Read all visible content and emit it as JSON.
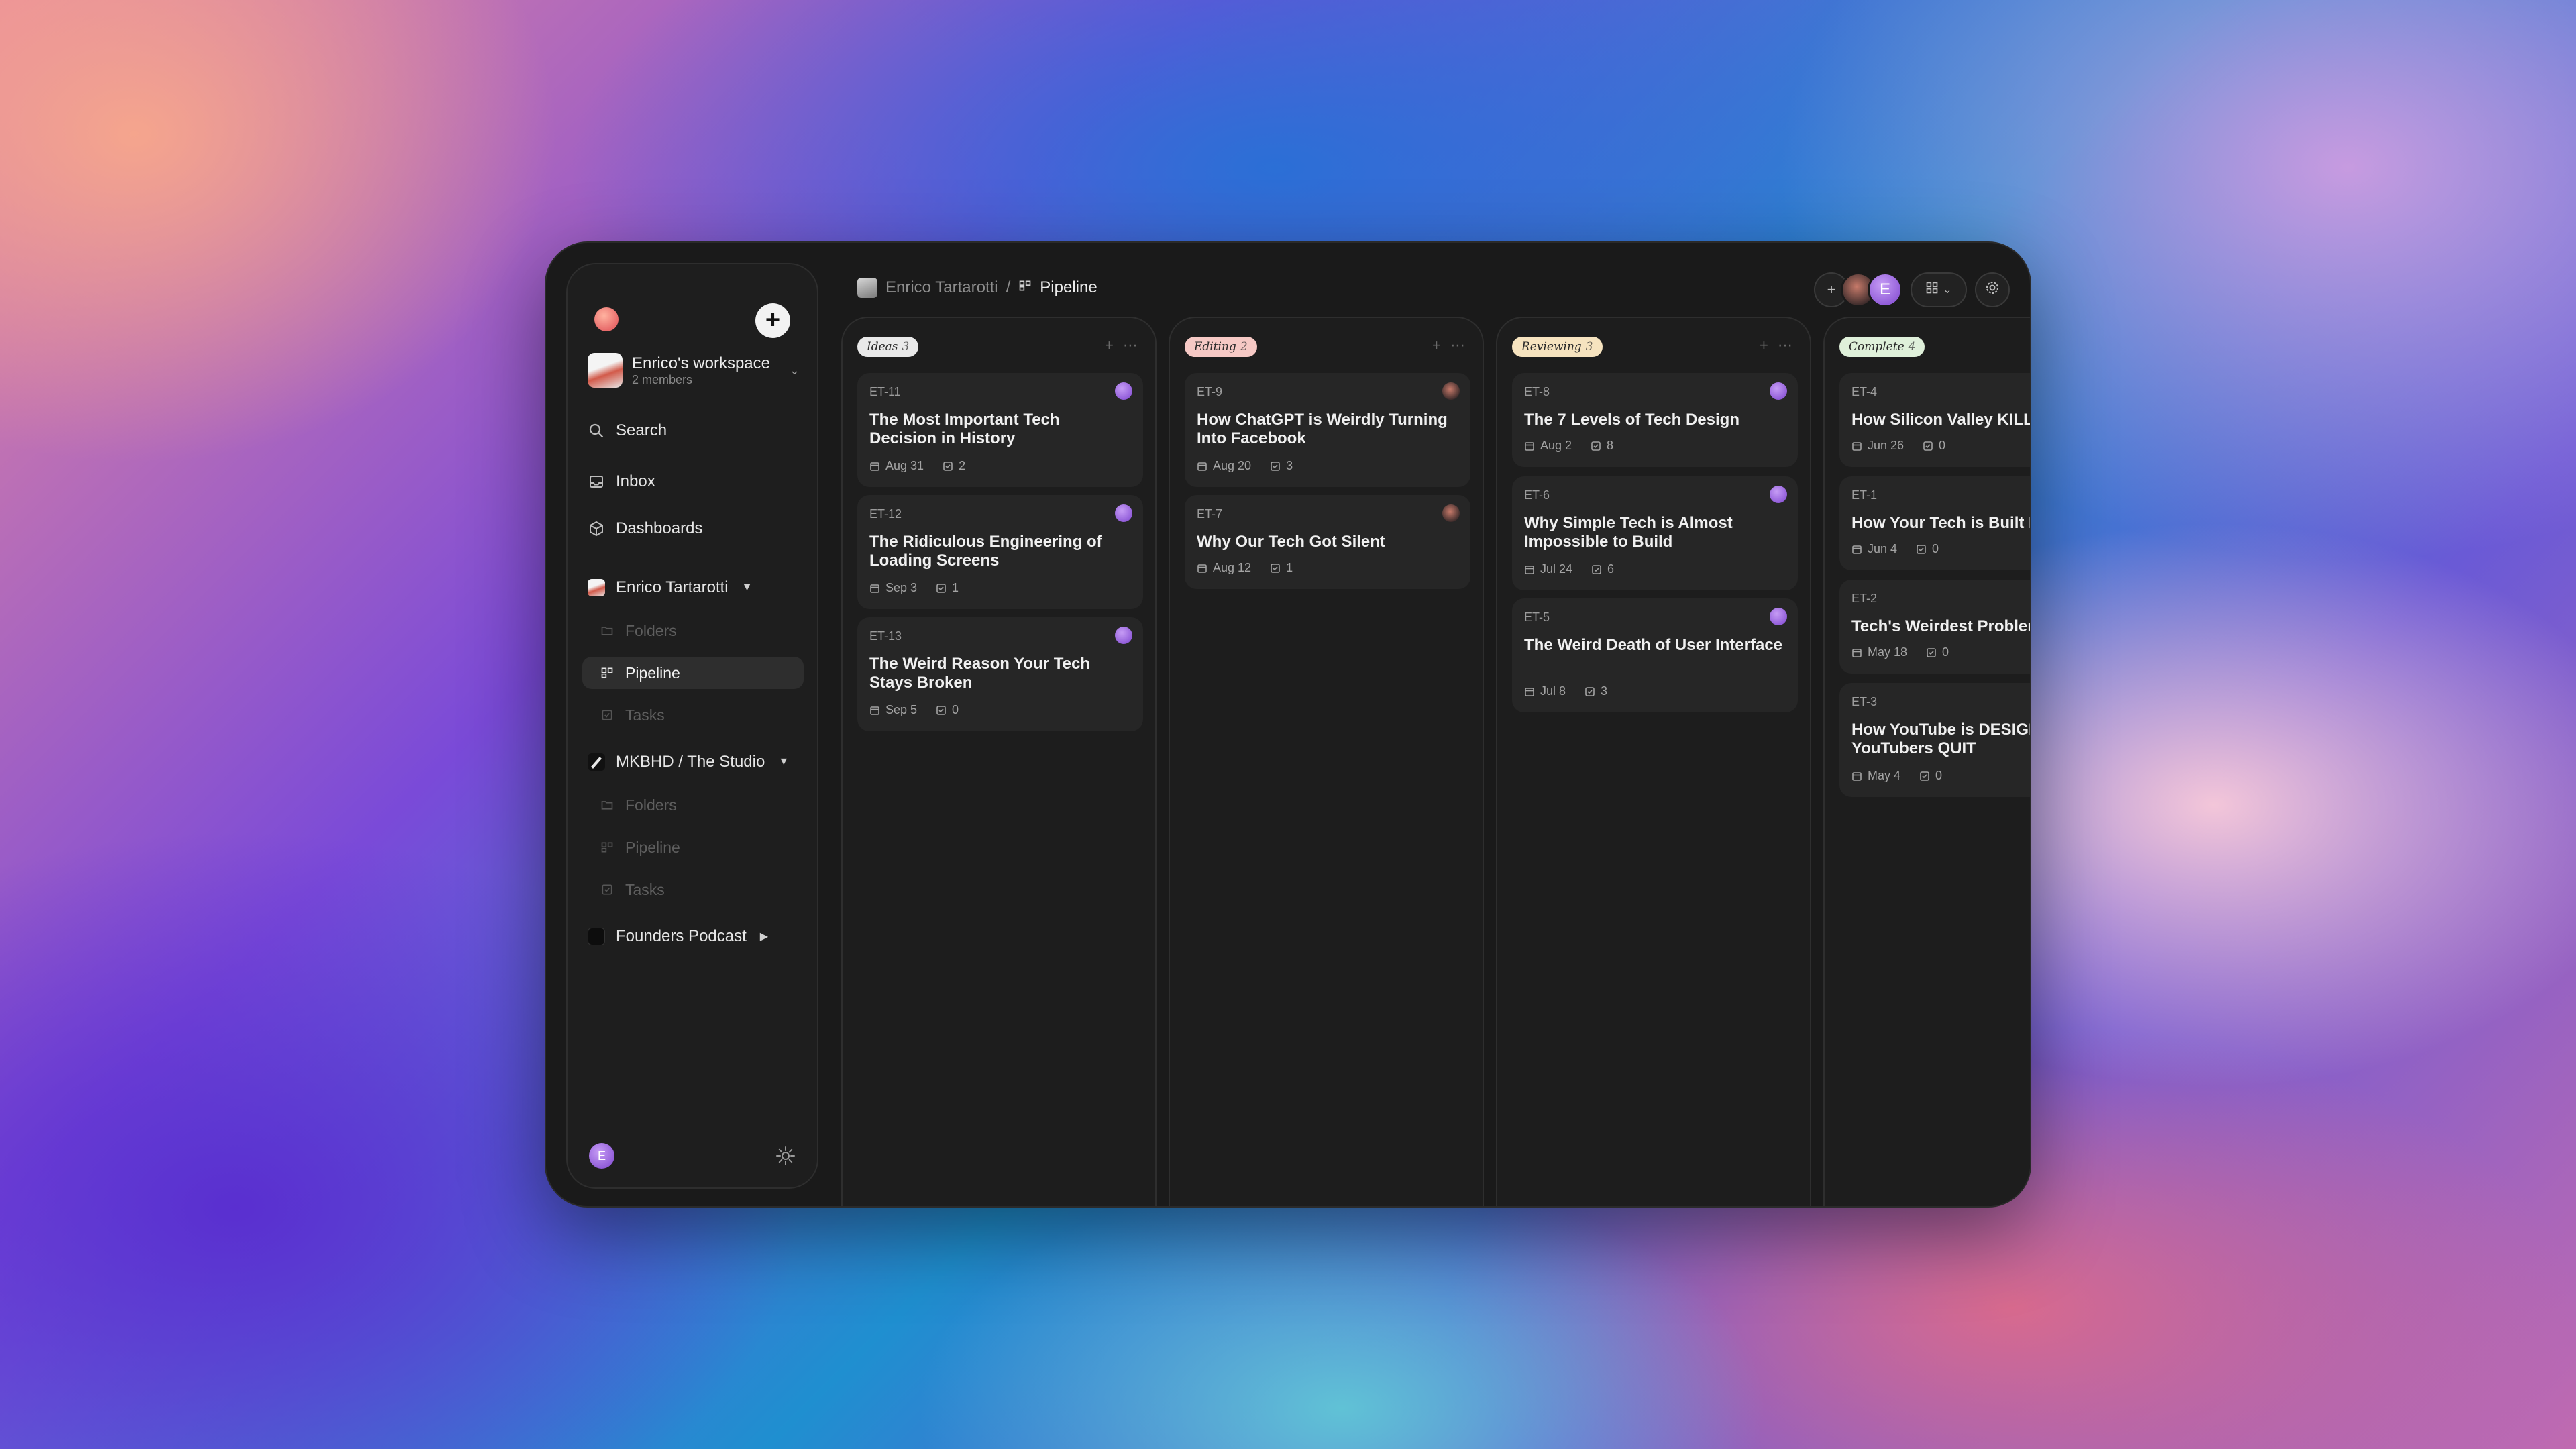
{
  "app": {
    "workspace_name": "Enrico's workspace",
    "workspace_members": "2 members"
  },
  "sidebar": {
    "search_label": "Search",
    "inbox_label": "Inbox",
    "dashboards_label": "Dashboards",
    "projects": [
      {
        "name": "Enrico Tartarotti",
        "items": [
          {
            "label": "Folders",
            "active": false
          },
          {
            "label": "Pipeline",
            "active": true
          },
          {
            "label": "Tasks",
            "active": false
          }
        ]
      },
      {
        "name": "MKBHD / The Studio",
        "items": [
          {
            "label": "Folders",
            "active": false
          },
          {
            "label": "Pipeline",
            "active": false
          },
          {
            "label": "Tasks",
            "active": false
          }
        ]
      },
      {
        "name": "Founders Podcast",
        "items": []
      }
    ],
    "user_initial": "E"
  },
  "header": {
    "breadcrumb_parent": "Enrico Tartarotti",
    "breadcrumb_sep": "/",
    "breadcrumb_current": "Pipeline",
    "avatar_initial": "E"
  },
  "board": {
    "columns": [
      {
        "name": "Ideas",
        "count": "3",
        "color": "#e9e9e9",
        "cards": [
          {
            "id": "ET-11",
            "title": "The Most Important Tech Decision in History",
            "date": "Aug 31",
            "tasks": "2"
          },
          {
            "id": "ET-12",
            "title": "The Ridiculous Engineering of Loading Screens",
            "date": "Sep 3",
            "tasks": "1"
          },
          {
            "id": "ET-13",
            "title": "The Weird Reason Your Tech Stays Broken",
            "date": "Sep 5",
            "tasks": "0"
          }
        ]
      },
      {
        "name": "Editing",
        "count": "2",
        "color": "#f6c9c5",
        "cards": [
          {
            "id": "ET-9",
            "title": "How ChatGPT is Weirdly Turning Into Facebook",
            "date": "Aug 20",
            "tasks": "3"
          },
          {
            "id": "ET-7",
            "title": "Why Our Tech Got Silent",
            "date": "Aug 12",
            "tasks": "1"
          }
        ]
      },
      {
        "name": "Reviewing",
        "count": "3",
        "color": "#f6e3bf",
        "cards": [
          {
            "id": "ET-8",
            "title": "The 7 Levels of Tech Design",
            "date": "Aug 2",
            "tasks": "8"
          },
          {
            "id": "ET-6",
            "title": "Why Simple Tech is Almost Impossible to Build",
            "date": "Jul 24",
            "tasks": "6"
          },
          {
            "id": "ET-5",
            "title": "The Weird Death of User Interface",
            "date": "Jul 8",
            "tasks": "3"
          }
        ]
      },
      {
        "name": "Complete",
        "count": "4",
        "color": "#dff0da",
        "cards": [
          {
            "id": "ET-4",
            "title": "How Silicon Valley KILLE",
            "date": "Jun 26",
            "tasks": "0"
          },
          {
            "id": "ET-1",
            "title": "How Your Tech is Built Fo",
            "date": "Jun 4",
            "tasks": "0"
          },
          {
            "id": "ET-2",
            "title": "Tech's Weirdest Problem",
            "date": "May 18",
            "tasks": "0"
          },
          {
            "id": "ET-3",
            "title": "How YouTube is DESIGN Make YouTubers QUIT",
            "date": "May 4",
            "tasks": "0"
          }
        ]
      }
    ]
  }
}
